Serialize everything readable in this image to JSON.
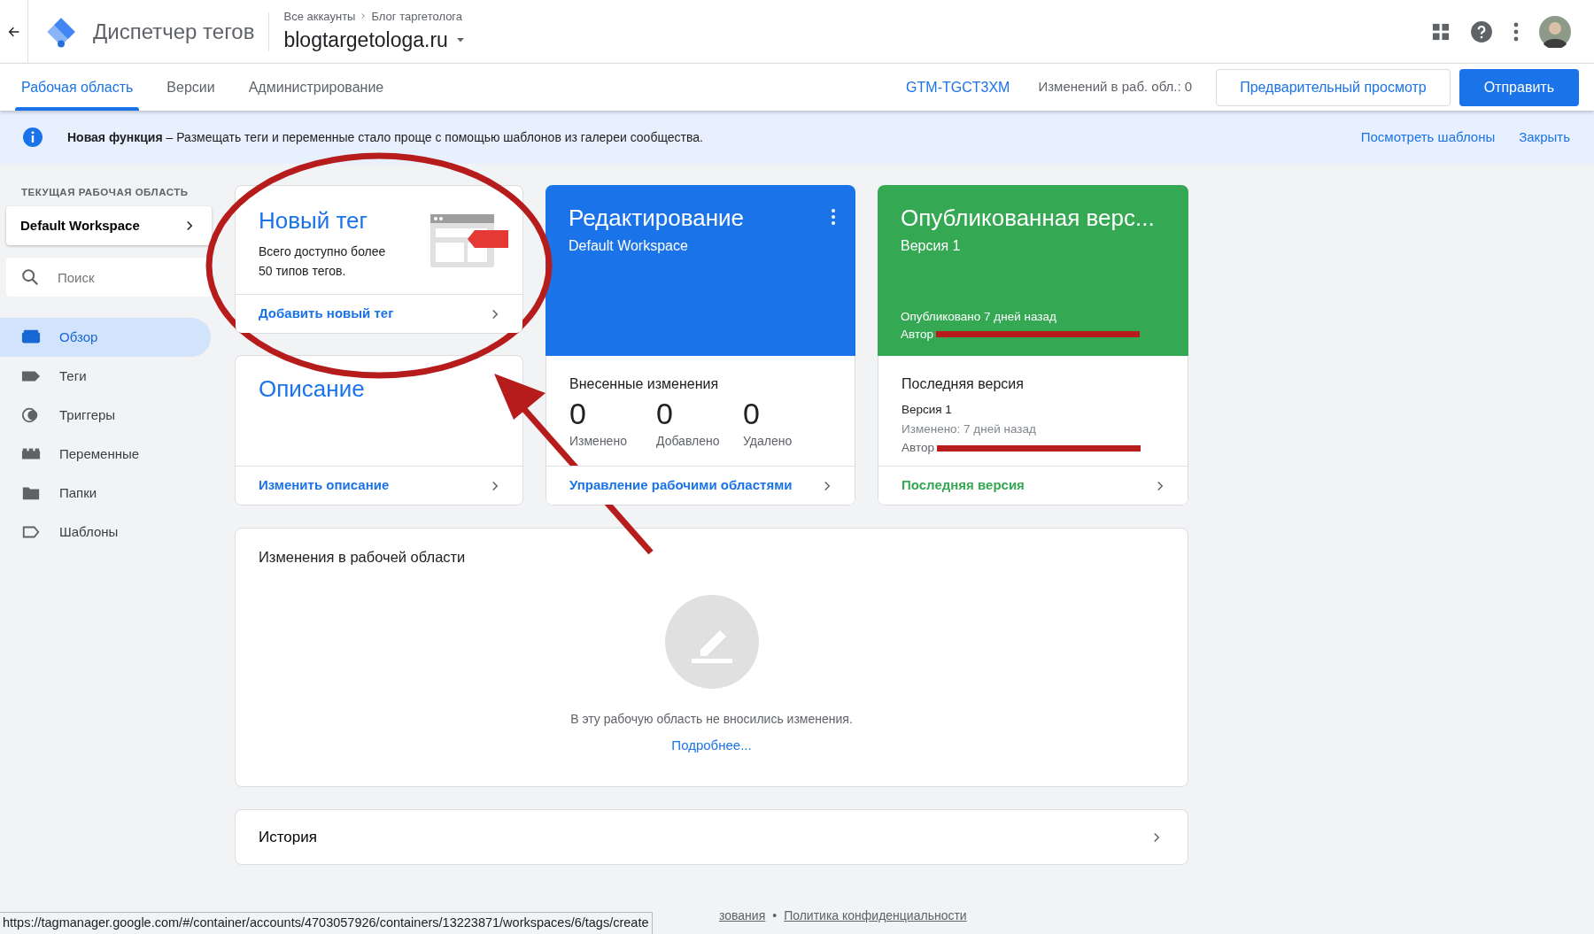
{
  "header": {
    "app_title": "Диспетчер тегов",
    "breadcrumb": [
      "Все аккаунты",
      "Блог таргетолога"
    ],
    "container_name": "blogtargetologa.ru"
  },
  "tabs": [
    {
      "label": "Рабочая область",
      "selected": true
    },
    {
      "label": "Версии",
      "selected": false
    },
    {
      "label": "Администрирование",
      "selected": false
    }
  ],
  "container_id": "GTM-TGCT3XM",
  "changes_count": "Изменений в раб. обл.: 0",
  "preview_button": "Предварительный просмотр",
  "submit_button": "Отправить",
  "banner": {
    "text": "**Новая функция** – Размещать теги и переменные стало проще с помощью шаблонов из галереи сообщества.",
    "actions": [
      "Посмотреть шаблоны",
      "Закрыть"
    ]
  },
  "sidebar": {
    "section_label": "ТЕКУЩАЯ РАБОЧАЯ ОБЛАСТЬ",
    "workspace": "Default Workspace",
    "search": {
      "placeholder": "Поиск"
    },
    "items": [
      {
        "label": "Обзор",
        "selected": true
      },
      {
        "label": "Теги",
        "selected": false
      },
      {
        "label": "Триггеры",
        "selected": false
      },
      {
        "label": "Переменные",
        "selected": false
      },
      {
        "label": "Папки",
        "selected": false
      },
      {
        "label": "Шаблоны",
        "selected": false
      }
    ]
  },
  "new_tag_card": {
    "title": "Новый тег",
    "text": "Всего доступно более 50 типов тегов.",
    "link": "Добавить новый тег"
  },
  "description_card": {
    "title": "Описание",
    "link": "Изменить описание"
  },
  "editing_card": {
    "title": "Редактирование",
    "subtitle": "Default Workspace",
    "changes_title": "Внесенные изменения",
    "stats": [
      {
        "value": "0",
        "label": "Изменено"
      },
      {
        "value": "0",
        "label": "Добавлено"
      },
      {
        "value": "0",
        "label": "Удалено"
      }
    ],
    "link": "Управление рабочими областями"
  },
  "published_card": {
    "title": "Опубликованная верс...",
    "subtitle": "Версия 1",
    "published": "Опубликовано 7 дней назад",
    "author": "Автор",
    "latest_title": "Последняя версия",
    "latest_version": "Версия 1",
    "modified": "Изменено: 7 дней назад",
    "latest_author": "Автор",
    "link": "Последняя версия"
  },
  "workspace_changes": {
    "title": "Изменения в рабочей области",
    "empty_text": "В эту рабочую область не вносились изменения.",
    "link": "Подробнее..."
  },
  "history": {
    "title": "История"
  },
  "footer": {
    "links": [
      "зования",
      "Политика конфиденциальности"
    ],
    "separator": "•"
  },
  "status_bar": {
    "url": "https://tagmanager.google.com/#/container/accounts/4703057926/containers/13223871/workspaces/6/tags/create"
  }
}
